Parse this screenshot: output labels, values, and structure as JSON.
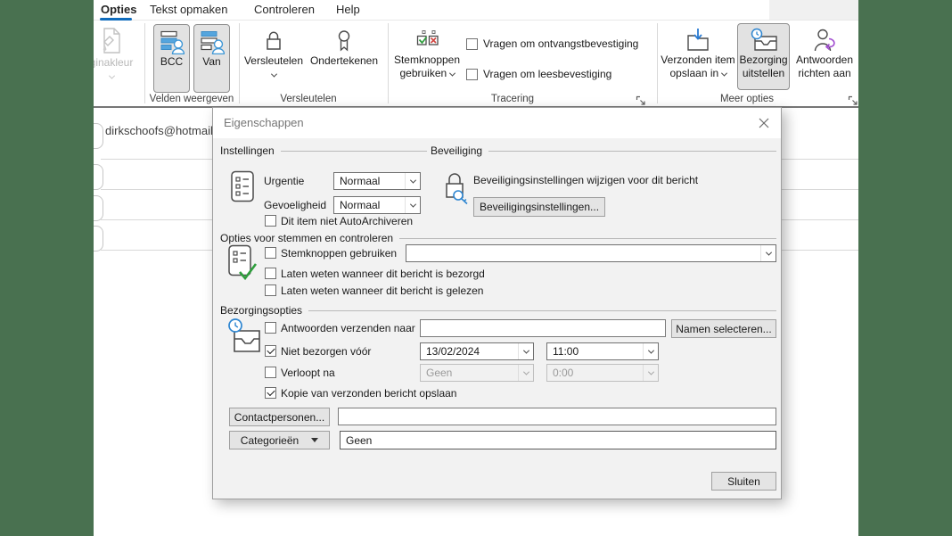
{
  "colors": {
    "desktop_green": "#497150",
    "accent_blue": "#0f6cbd",
    "icon_blue": "#3f97d6",
    "icon_green": "#2f9e3d",
    "icon_red": "#d04540",
    "icon_purple": "#a24fd0",
    "dialog_bg": "#f2f2f2"
  },
  "tabs": {
    "opties": "Opties",
    "tekst_opmaken": "Tekst opmaken",
    "controleren": "Controleren",
    "help": "Help"
  },
  "ribbon": {
    "paginakleur": "ginakleur",
    "bcc": "BCC",
    "van": "Van",
    "group_velden": "Velden weergeven",
    "versleutelen": "Versleutelen",
    "ondertekenen": "Ondertekenen",
    "group_versleutelen": "Versleutelen",
    "stemknoppen_line1": "Stemknoppen",
    "stemknoppen_line2": "gebruiken",
    "vragen_ontvangst": "Vragen om ontvangstbevestiging",
    "vragen_lees": "Vragen om leesbevestiging",
    "group_tracering": "Tracering",
    "verzonden_line1": "Verzonden item",
    "verzonden_line2": "opslaan in",
    "bezorging_line1": "Bezorging",
    "bezorging_line2": "uitstellen",
    "antwoorden_line1": "Antwoorden",
    "antwoorden_line2": "richten aan",
    "group_meer": "Meer opties"
  },
  "compose": {
    "from_email": "dirkschoofs@hotmail."
  },
  "dialog": {
    "title": "Eigenschappen",
    "section_instellingen": "Instellingen",
    "section_beveiliging": "Beveiliging",
    "section_stemmen": "Opties voor stemmen en controleren",
    "section_bezorging": "Bezorgingsopties",
    "urgentie_label": "Urgentie",
    "urgentie_value": "Normaal",
    "gevoeligheid_label": "Gevoeligheid",
    "gevoeligheid_value": "Normaal",
    "autoarchiveren_label": "Dit item niet AutoArchiveren",
    "beveiliging_text": "Beveiligingsinstellingen wijzigen voor dit bericht",
    "beveiliging_button": "Beveiligingsinstellingen...",
    "stemknoppen_label": "Stemknoppen gebruiken",
    "stemknoppen_value": "",
    "bezorgd_label": "Laten weten wanneer dit bericht is bezorgd",
    "gelezen_label": "Laten weten wanneer dit bericht is gelezen",
    "antwoorden_label": "Antwoorden verzenden naar",
    "antwoorden_value": "",
    "namen_button": "Namen selecteren...",
    "niet_bezorgen_label": "Niet bezorgen vóór",
    "bezorg_datum": "13/02/2024",
    "bezorg_tijd": "11:00",
    "verloopt_label": "Verloopt na",
    "verloop_datum": "Geen",
    "verloop_tijd": "0:00",
    "kopie_label": "Kopie van verzonden bericht opslaan",
    "contactpersonen_button": "Contactpersonen...",
    "contact_value": "",
    "categorieen_button": "Categorieën",
    "categorieen_value": "Geen",
    "sluiten_button": "Sluiten",
    "checkboxes": {
      "vragen_ontvangst": false,
      "vragen_lees": false,
      "autoarchiveren": false,
      "stemknoppen": false,
      "bezorgd": false,
      "gelezen": false,
      "antwoorden_naar": false,
      "niet_bezorgen": true,
      "verloopt": false,
      "kopie": true
    }
  }
}
